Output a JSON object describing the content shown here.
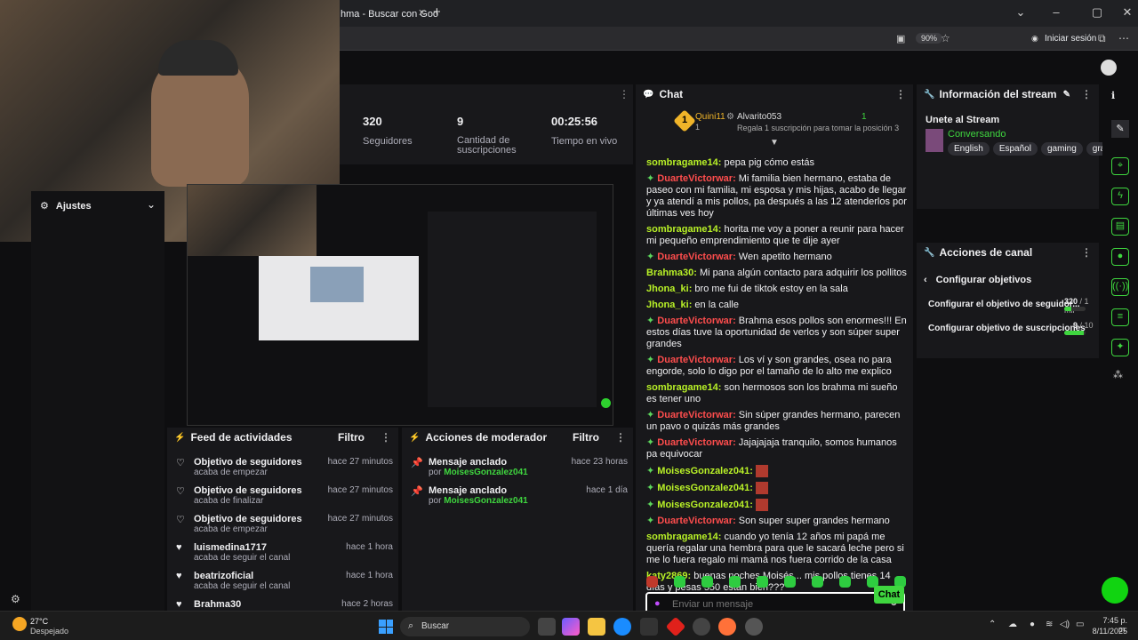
{
  "browser": {
    "tab_title": "hma - Buscar con Goo",
    "zoom": "90%",
    "signin": "Iniciar sesión"
  },
  "stats": {
    "followers_value": "320",
    "followers_label": "Seguidores",
    "subs_value": "9",
    "subs_label": "Cantidad de suscripciones",
    "uptime_value": "00:25:56",
    "uptime_label": "Tiempo en vivo"
  },
  "settings": {
    "label": "Ajustes"
  },
  "chat": {
    "title": "Chat",
    "top1_name": "Quini11",
    "top1_count": "1",
    "top2_name": "Alvarito053",
    "top2_count": "1",
    "gift_text": "Regala 1 suscripción para tomar la posición 3",
    "messages": [
      {
        "user": "sombragame14",
        "text": "pepa pig cómo estás",
        "color": "green"
      },
      {
        "user": "DuarteVictorwar",
        "text": "Mi familia bien hermano, estaba de paseo con mi familia, mi esposa y mis hijas, acabo de llegar y ya atendí a mis pollos, pa después a las 12 atenderlos por últimas ves hoy",
        "color": "red"
      },
      {
        "user": "sombragame14",
        "text": "horita me voy a poner a reunir para hacer mi pequeño emprendimiento que te dije ayer",
        "color": "green"
      },
      {
        "user": "DuarteVictorwar",
        "text": "Wen apetito hermano",
        "color": "red"
      },
      {
        "user": "Brahma30",
        "text": "Mi pana algún contacto para adquirir los pollitos",
        "color": "green"
      },
      {
        "user": "Jhona_ki",
        "text": "bro me fui de tiktok estoy en la sala",
        "color": "green"
      },
      {
        "user": "Jhona_ki",
        "text": "en la calle",
        "color": "green"
      },
      {
        "user": "DuarteVictorwar",
        "text": "Brahma esos pollos son enormes!!! En estos días tuve la oportunidad de verlos y son súper super grandes",
        "color": "red"
      },
      {
        "user": "DuarteVictorwar",
        "text": "Los ví y son grandes, osea no para engorde, solo lo digo por el tamaño de lo alto me explico",
        "color": "red"
      },
      {
        "user": "sombragame14",
        "text": "son hermosos son los brahma mi sueño es tener uno",
        "color": "green"
      },
      {
        "user": "DuarteVictorwar",
        "text": "Sin súper grandes hermano, parecen un pavo o quizás más grandes",
        "color": "red"
      },
      {
        "user": "DuarteVictorwar",
        "text": "Jajajajaja tranquilo, somos humanos pa equivocar",
        "color": "red"
      },
      {
        "user": "MoisesGonzalez041",
        "text": "",
        "color": "green"
      },
      {
        "user": "MoisesGonzalez041",
        "text": "",
        "color": "green"
      },
      {
        "user": "MoisesGonzalez041",
        "text": "",
        "color": "green"
      },
      {
        "user": "DuarteVictorwar",
        "text": "Son super super grandes hermano",
        "color": "red"
      },
      {
        "user": "sombragame14",
        "text": "cuando yo tenía 12 años mi papá me quería regalar una hembra para que le sacará leche pero si me lo fuera regalo mi mamá nos fuera corrido de la casa",
        "color": "green"
      },
      {
        "user": "katy2869",
        "text": "buenas noches Moisés... mis pollos tienes 14 días y pesas 550 están bien???",
        "color": "green"
      }
    ],
    "input_placeholder": "Enviar un mensaje",
    "send_label": "Chat"
  },
  "stream_info": {
    "title": "Información del stream",
    "stream_title": "Unete al Stream",
    "category": "Conversando",
    "tags": [
      "English",
      "Español",
      "gaming",
      "granja"
    ]
  },
  "channel_actions": {
    "title": "Acciones de canal",
    "back_label": "Configurar objetivos",
    "goal1_label": "Configurar el objetivo de seguidor...",
    "goal1_value": "320",
    "goal1_total": "/ 1 mil",
    "goal1_progress": 0.32,
    "goal2_label": "Configurar objetivo de suscripciones",
    "goal2_value": "9",
    "goal2_total": "/ 10",
    "goal2_progress": 0.9
  },
  "feed": {
    "title": "Feed de actividades",
    "filter": "Filtro",
    "items": [
      {
        "title": "Objetivo de seguidores",
        "sub": "acaba de empezar",
        "time": "hace 27 minutos"
      },
      {
        "title": "Objetivo de seguidores",
        "sub": "acaba de finalizar",
        "time": "hace 27 minutos"
      },
      {
        "title": "Objetivo de seguidores",
        "sub": "acaba de empezar",
        "time": "hace 27 minutos"
      },
      {
        "title": "luismedina1717",
        "sub": "acaba de seguir el canal",
        "time": "hace 1 hora"
      },
      {
        "title": "beatrizoficial",
        "sub": "acaba de seguir el canal",
        "time": "hace 1 hora"
      },
      {
        "title": "Brahma30",
        "sub": "",
        "time": "hace 2 horas"
      }
    ]
  },
  "mod": {
    "title": "Acciones de moderador",
    "filter": "Filtro",
    "items": [
      {
        "title": "Mensaje anclado",
        "by": "por",
        "user": "MoisesGonzalez041",
        "time": "hace 23 horas"
      },
      {
        "title": "Mensaje anclado",
        "by": "por",
        "user": "MoisesGonzalez041",
        "time": "hace 1 día"
      }
    ]
  },
  "taskbar": {
    "temp": "27°C",
    "weather": "Despejado",
    "search": "Buscar",
    "time": "7:45 p. m.",
    "date": "8/11/2025"
  },
  "colors": {
    "accent": "#3fd63f",
    "username_green": "#b9f227",
    "username_red": "#ff4d4d"
  }
}
